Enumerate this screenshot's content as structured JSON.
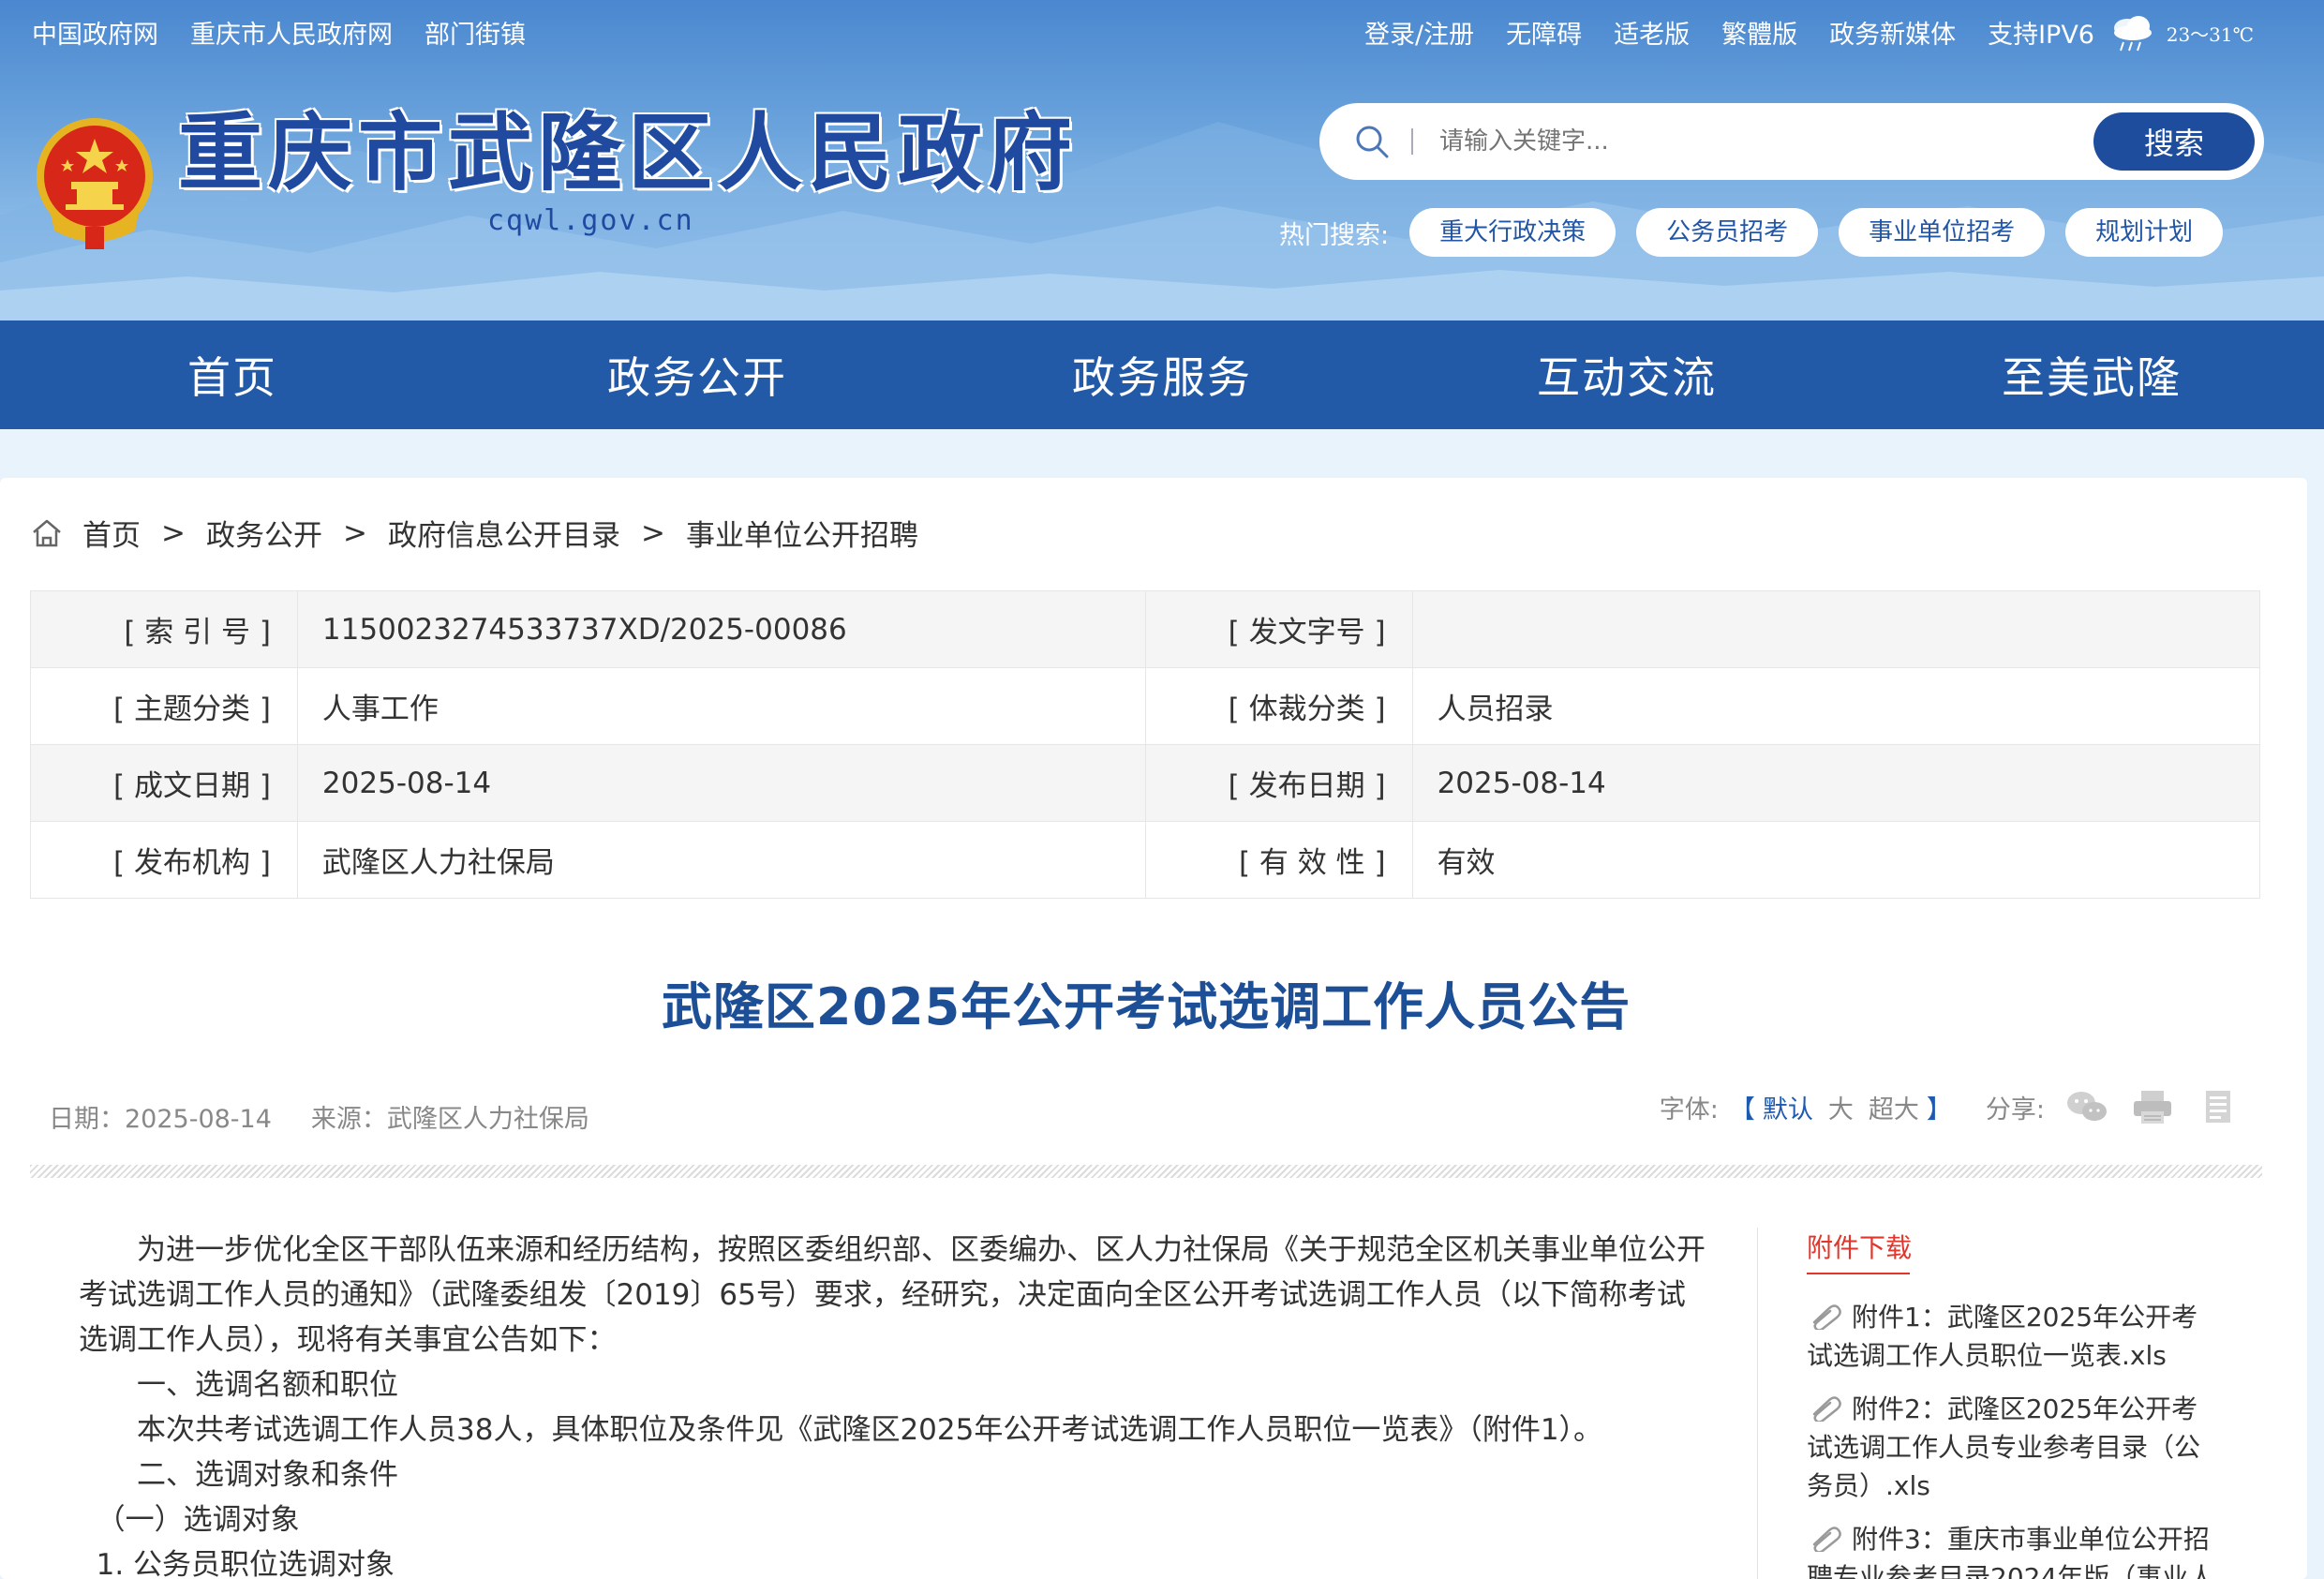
{
  "header": {
    "top_links": [
      "中国政府网",
      "重庆市人民政府网",
      "部门街镇"
    ],
    "right_links": [
      "登录/注册",
      "无障碍",
      "适老版",
      "繁體版",
      "政务新媒体",
      "支持IPV6"
    ],
    "weather": "23～31℃",
    "site_title": "重庆市武隆区人民政府",
    "site_domain": "cqwl.gov.cn",
    "search_placeholder": "请输入关键字...",
    "search_button": "搜索",
    "hot_label": "热门搜索:",
    "hot_tags": [
      "重大行政决策",
      "公务员招考",
      "事业单位招考",
      "规划计划"
    ]
  },
  "nav": [
    "首页",
    "政务公开",
    "政务服务",
    "互动交流",
    "至美武隆"
  ],
  "breadcrumb": [
    "首页",
    "政务公开",
    "政府信息公开目录",
    "事业单位公开招聘"
  ],
  "meta": [
    {
      "l1": "[ 索 引 号 ]",
      "v1": "1150023274533737XD/2025-00086",
      "l2": "[ 发文字号 ]",
      "v2": ""
    },
    {
      "l1": "[ 主题分类 ]",
      "v1": "人事工作",
      "l2": "[ 体裁分类 ]",
      "v2": "人员招录"
    },
    {
      "l1": "[ 成文日期 ]",
      "v1": "2025-08-14",
      "l2": "[ 发布日期 ]",
      "v2": "2025-08-14"
    },
    {
      "l1": "[ 发布机构 ]",
      "v1": "武隆区人力社保局",
      "l2": "[ 有 效 性 ]",
      "v2": "有效"
    }
  ],
  "article": {
    "title": "武隆区2025年公开考试选调工作人员公告",
    "date": "日期：2025-08-14",
    "source": "来源：武隆区人力社保局",
    "font_label": "字体:",
    "font_open": "【",
    "font_options": [
      "默认",
      "大",
      "超大"
    ],
    "font_close": "】",
    "share_label": "分享:",
    "paragraphs": [
      "为进一步优化全区干部队伍来源和经历结构，按照区委组织部、区委编办、区人力社保局《关于规范全区机关事业单位公开考试选调工作人员的通知》（武隆委组发〔2019〕65号）要求，经研究，决定面向全区公开考试选调工作人员（以下简称考试选调工作人员），现将有关事宜公告如下：",
      "一、选调名额和职位",
      "本次共考试选调工作人员38人，具体职位及条件见《武隆区2025年公开考试选调工作人员职位一览表》（附件1）。",
      "二、选调对象和条件",
      "（一）选调对象",
      "1. 公务员职位选调对象"
    ]
  },
  "attachments": {
    "heading": "附件下载",
    "items": [
      "附件1：武隆区2025年公开考试选调工作人员职位一览表.xls",
      "附件2：武隆区2025年公开考试选调工作人员专业参考目录（公务员）.xls",
      "附件3：重庆市事业单位公开招聘专业参考目录2024年版（事业人"
    ]
  },
  "colors": {
    "nav_bg": "#235aa8",
    "title_blue": "#1d4f97",
    "attach_red": "#e2362c"
  }
}
